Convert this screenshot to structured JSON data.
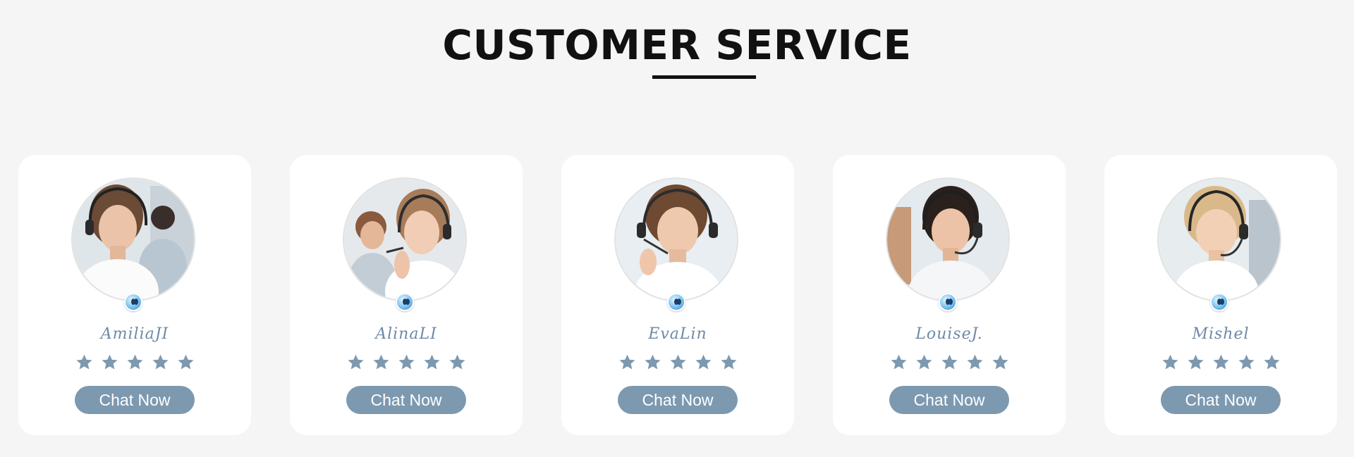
{
  "heading": {
    "title": "CUSTOMER SERVICE"
  },
  "theme": {
    "background": "#f5f5f5",
    "card_background": "#ffffff",
    "accent": "#7d99b0",
    "name_color": "#6f8aa4",
    "star_color": "#7d99b0"
  },
  "agents": [
    {
      "name": "AmiliaJI",
      "rating": 5,
      "button_label": "Chat Now",
      "badge_icon": "qq-penguin-icon"
    },
    {
      "name": "AlinaLI",
      "rating": 5,
      "button_label": "Chat Now",
      "badge_icon": "qq-penguin-icon"
    },
    {
      "name": "EvaLin",
      "rating": 5,
      "button_label": "Chat Now",
      "badge_icon": "qq-penguin-icon"
    },
    {
      "name": "LouiseJ.",
      "rating": 5,
      "button_label": "Chat Now",
      "badge_icon": "qq-penguin-icon"
    },
    {
      "name": "Mishel",
      "rating": 5,
      "button_label": "Chat Now",
      "badge_icon": "qq-penguin-icon"
    }
  ]
}
